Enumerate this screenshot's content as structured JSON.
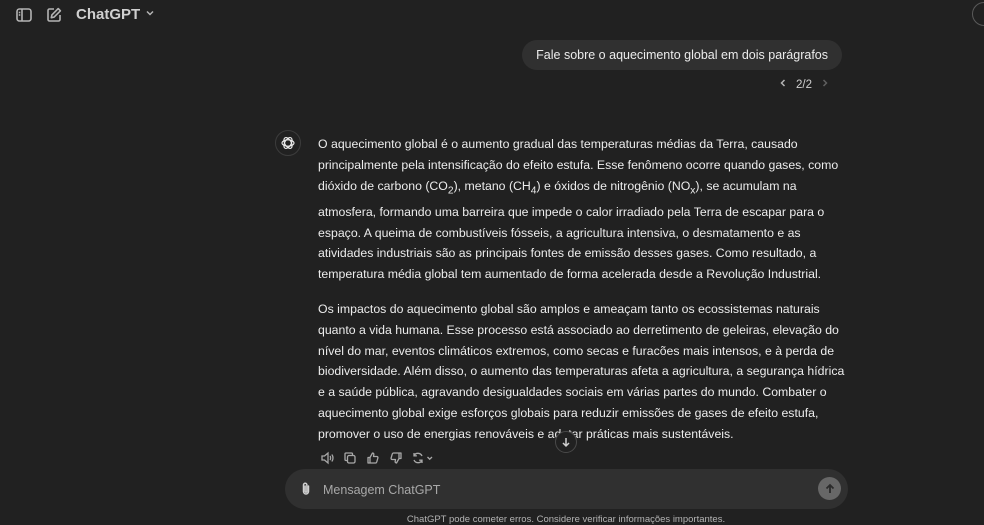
{
  "header": {
    "model_name": "ChatGPT",
    "icons": [
      "sidebar-icon",
      "new-chat-icon",
      "chevron-down-icon"
    ]
  },
  "conversation": {
    "user_message": "Fale sobre o aquecimento global em dois parágrafos",
    "pager": "2/2",
    "assistant": {
      "p1_parts": [
        "O aquecimento global é o aumento gradual das temperaturas médias da Terra, causado principalmente pela intensificação do efeito estufa. Esse fenômeno ocorre quando gases, como dióxido de carbono (CO",
        "2",
        "), metano (CH",
        "4",
        ") e óxidos de nitrogênio (NO",
        "x",
        "), se acumulam na atmosfera, formando uma barreira que impede o calor irradiado pela Terra de escapar para o espaço. A queima de combustíveis fósseis, a agricultura intensiva, o desmatamento e as atividades industriais são as principais fontes de emissão desses gases. Como resultado, a temperatura média global tem aumentado de forma acelerada desde a Revolução Industrial."
      ],
      "p2": "Os impactos do aquecimento global são amplos e ameaçam tanto os ecossistemas naturais quanto a vida humana. Esse processo está associado ao derretimento de geleiras, elevação do nível do mar, eventos climáticos extremos, como secas e furacões mais intensos, e à perda de biodiversidade. Além disso, o aumento das temperaturas afeta a agricultura, a segurança hídrica e a saúde pública, agravando desigualdades sociais em várias partes do mundo. Combater o aquecimento global exige esforços globais para reduzir emissões de gases de efeito estufa, promover o uso de energias renováveis e adotar práticas mais sustentáveis."
    },
    "actions": [
      "read-aloud-icon",
      "copy-icon",
      "thumbs-up-icon",
      "thumbs-down-icon",
      "regenerate-icon"
    ]
  },
  "composer": {
    "placeholder": "Mensagem ChatGPT"
  },
  "footer": {
    "disclaimer": "ChatGPT pode cometer erros. Considere verificar informações importantes."
  },
  "colors": {
    "background": "#212121",
    "bubble": "#303030",
    "text": "#ececec",
    "muted": "#b4b4b4"
  }
}
